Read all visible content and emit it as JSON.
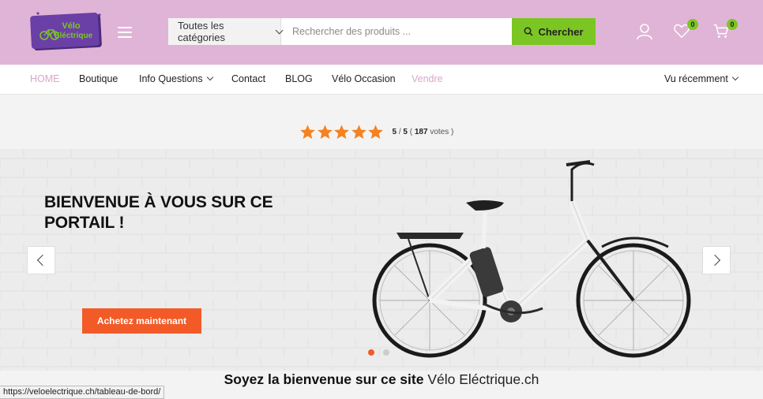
{
  "header": {
    "logo_line1": "Vélo",
    "logo_line2": "Eléctrique",
    "category_select": "Toutes les catégories",
    "search_placeholder": "Rechercher des produits ...",
    "search_button": "Chercher",
    "wishlist_count": "0",
    "cart_count": "0"
  },
  "nav": {
    "items": [
      "HOME",
      "Boutique",
      "Info Questions",
      "Contact",
      "BLOG",
      "Vélo Occasion",
      "Vendre"
    ],
    "recent": "Vu récemment"
  },
  "rating": {
    "stars": 5,
    "score": "5",
    "sep": "/",
    "max": "5",
    "open": "(",
    "votes": "187",
    "votes_label": "votes )"
  },
  "hero": {
    "title": "BIENVENUE À VOUS SUR CE PORTAIL !",
    "cta": "Achetez maintenant",
    "slides": 2,
    "active_slide": 1
  },
  "welcome": {
    "text": "Soyez la bienvenue sur ce site",
    "site": "Vélo Eléctrique.ch"
  },
  "status_url": "https://veloelectrique.ch/tableau-de-bord/",
  "colors": {
    "header_bg": "#e0b4d6",
    "accent_green": "#7cc623",
    "cta_orange": "#f25b27",
    "nav_pink": "#d9a6cd",
    "star": "#f58220"
  }
}
